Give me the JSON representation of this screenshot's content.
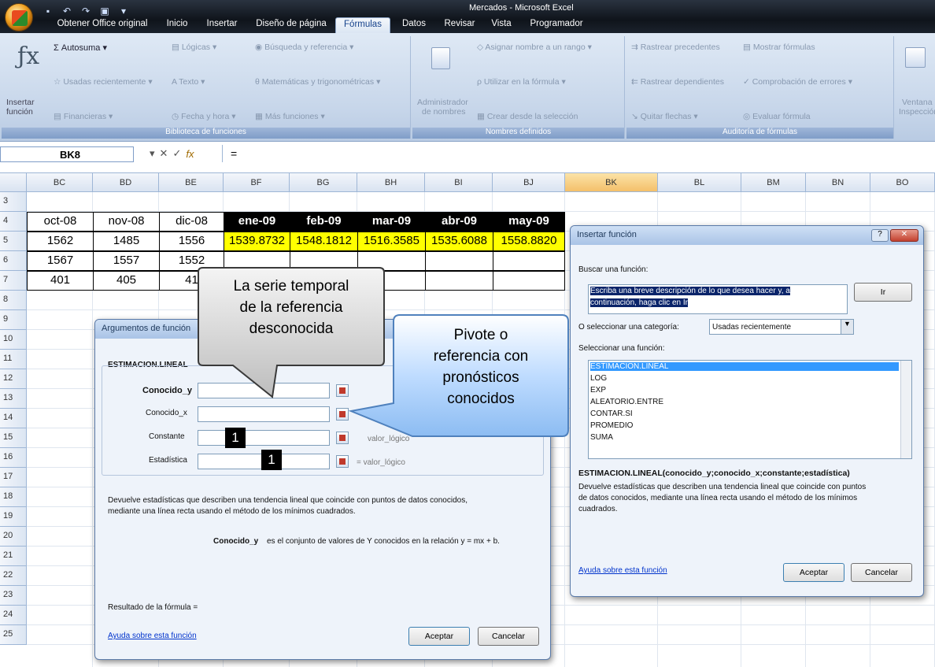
{
  "window": {
    "title": "Mercados - Microsoft Excel",
    "tabs": [
      "Obtener Office original",
      "Inicio",
      "Insertar",
      "Diseño de página",
      "Fórmulas",
      "Datos",
      "Revisar",
      "Vista",
      "Programador"
    ],
    "active_tab": "Fórmulas"
  },
  "ribbon": {
    "insert_function": [
      "Insertar",
      "función"
    ],
    "autosuma": "Autosuma",
    "usadas": "Usadas recientemente",
    "financieras": "Financieras",
    "logicas": "Lógicas",
    "texto": "Texto",
    "fecha": "Fecha y hora",
    "busqueda": "Búsqueda y referencia",
    "matematicas": "Matemáticas y trigonométricas",
    "mas": "Más funciones",
    "group_biblioteca": "Biblioteca de funciones",
    "admin": [
      "Administrador",
      "de nombres"
    ],
    "asignar": "Asignar nombre a un rango",
    "utilizar": "Utilizar en la fórmula",
    "crear": "Crear desde la selección",
    "group_nombres": "Nombres definidos",
    "precedentes": "Rastrear precedentes",
    "dependientes": "Rastrear dependientes",
    "quitar": "Quitar flechas",
    "mostrar": "Mostrar fórmulas",
    "comprobacion": "Comprobación de errores",
    "evaluar": "Evaluar fórmula",
    "group_auditoria": "Auditoría de fórmulas",
    "ventana": [
      "Ventana",
      "Inspección"
    ]
  },
  "formula_bar": {
    "name_box": "BK8",
    "formula": "="
  },
  "columns": [
    "BC",
    "BD",
    "BE",
    "BF",
    "BG",
    "BH",
    "BI",
    "BJ",
    "BK",
    "BL",
    "BM",
    "BN",
    "BO"
  ],
  "selected_column": "BK",
  "rows": [
    "3",
    "4",
    "5",
    "6",
    "7",
    "8",
    "9",
    "10",
    "11",
    "12",
    "13",
    "14",
    "15",
    "16",
    "17",
    "18",
    "19",
    "20",
    "21",
    "22",
    "23",
    "24",
    "25"
  ],
  "table": {
    "headers": [
      "oct-08",
      "nov-08",
      "dic-08",
      "ene-09",
      "feb-09",
      "mar-09",
      "abr-09",
      "may-09"
    ],
    "row5": [
      "1562",
      "1485",
      "1556",
      "1539.8732",
      "1548.1812",
      "1516.3585",
      "1535.6088",
      "1558.8820"
    ],
    "row6": [
      "1567",
      "1557",
      "1552",
      "",
      "",
      "",
      "",
      ""
    ],
    "row7": [
      "401",
      "405",
      "41",
      "",
      "",
      "",
      "",
      ""
    ]
  },
  "args_dialog": {
    "title": "Argumentos de función",
    "func": "ESTIMACION.LINEAL",
    "labels": [
      "Conocido_y",
      "Conocido_x",
      "Constante",
      "Estadística"
    ],
    "hint_const": "valor_lógico",
    "hint_stat": "= valor_lógico",
    "description": [
      "Devuelve estadísticas que describen una tendencia lineal que coincide con puntos de datos conocidos,",
      "mediante una línea recta usando el método de los mínimos cuadrados."
    ],
    "arg_help_label": "Conocido_y",
    "arg_help": "es el conjunto de valores de Y conocidos en la relación y = mx + b.",
    "result_label": "Resultado de la fórmula =",
    "help_link": "Ayuda sobre esta función",
    "ok": "Aceptar",
    "cancel": "Cancelar"
  },
  "insert_dialog": {
    "title": "Insertar función",
    "search_label": "Buscar una función:",
    "search_value": [
      "Escriba una breve descripción de lo que desea hacer y, a",
      "continuación, haga clic en Ir"
    ],
    "go": "Ir",
    "category_label": "O seleccionar una categoría:",
    "category_value": "Usadas recientemente",
    "select_label": "Seleccionar una función:",
    "functions": [
      "ESTIMACION.LINEAL",
      "LOG",
      "EXP",
      "ALEATORIO.ENTRE",
      "CONTAR.SI",
      "PROMEDIO",
      "SUMA"
    ],
    "signature": "ESTIMACION.LINEAL(conocido_y;conocido_x;constante;estadística)",
    "description": [
      "Devuelve estadísticas que describen una tendencia lineal que coincide con puntos",
      "de datos conocidos, mediante una línea recta usando el método de los mínimos",
      "cuadrados."
    ],
    "help_link": "Ayuda sobre esta función",
    "ok": "Aceptar",
    "cancel": "Cancelar"
  },
  "callouts": {
    "left": [
      "La serie temporal",
      "de la referencia",
      "desconocida"
    ],
    "right": [
      "Pivote o",
      "referencia con",
      "pronósticos",
      "conocidos"
    ],
    "num1": "1",
    "num2": "1"
  }
}
